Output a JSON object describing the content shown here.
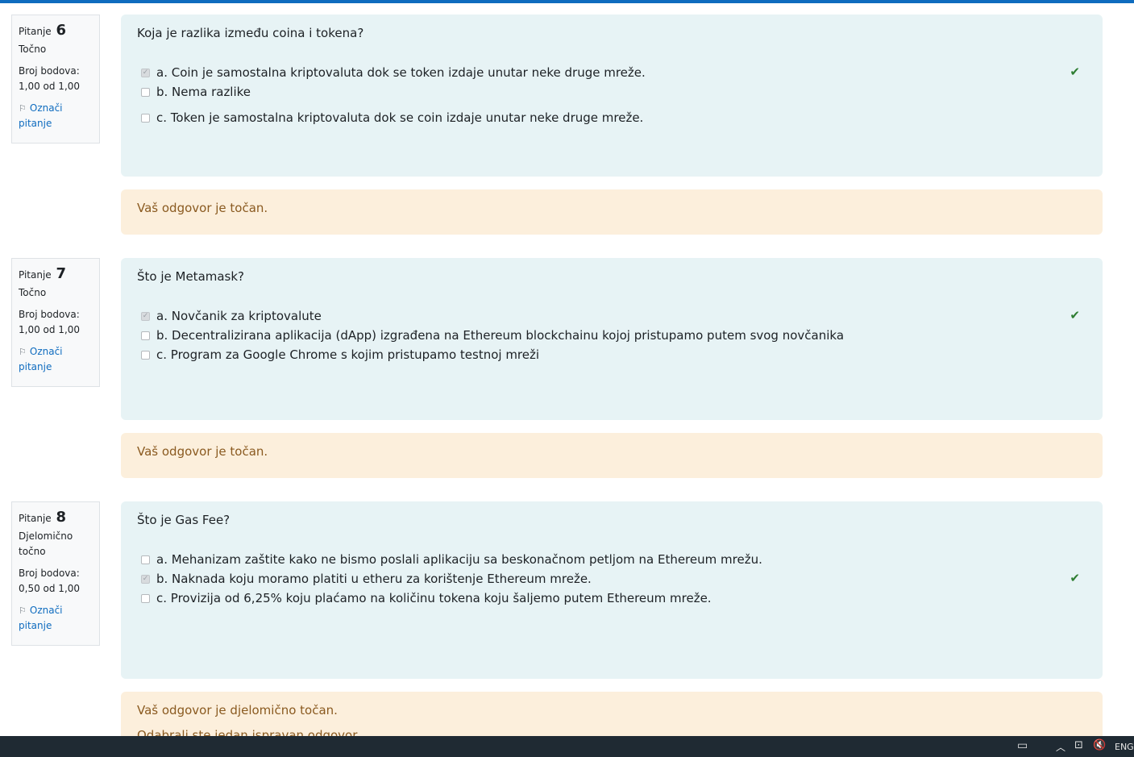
{
  "questions": [
    {
      "label": "Pitanje",
      "number": "6",
      "state": "Točno",
      "grade_label": "Broj bodova:",
      "grade_value": "1,00 od 1,00",
      "flag_label": "Označi pitanje",
      "text": "Koja je razlika između coina i tokena?",
      "answers": [
        {
          "text": "a. Coin je samostalna kriptovaluta dok se token izdaje unutar neke druge mreže.",
          "checked": true,
          "correct": true
        },
        {
          "text": "b. Nema razlike",
          "checked": false,
          "correct": false
        },
        {
          "text": "c. Token je samostalna kriptovaluta dok se coin izdaje unutar neke druge mreže.",
          "checked": false,
          "correct": false
        }
      ],
      "feedback": "Vaš odgovor je točan.",
      "feedback_sub": ""
    },
    {
      "label": "Pitanje",
      "number": "7",
      "state": "Točno",
      "grade_label": "Broj bodova:",
      "grade_value": "1,00 od 1,00",
      "flag_label": "Označi pitanje",
      "text": "Što je Metamask?",
      "answers": [
        {
          "text": "a. Novčanik za kriptovalute",
          "checked": true,
          "correct": true
        },
        {
          "text": "b. Decentralizirana aplikacija (dApp) izgrađena na Ethereum blockchainu kojoj pristupamo putem svog novčanika",
          "checked": false,
          "correct": false
        },
        {
          "text": "c. Program za Google Chrome s kojim pristupamo testnoj mreži",
          "checked": false,
          "correct": false
        }
      ],
      "feedback": "Vaš odgovor je točan.",
      "feedback_sub": ""
    },
    {
      "label": "Pitanje",
      "number": "8",
      "state": "Djelomično točno",
      "grade_label": "Broj bodova:",
      "grade_value": "0,50 od 1,00",
      "flag_label": "Označi pitanje",
      "text": "Što je Gas Fee?",
      "answers": [
        {
          "text": "a. Mehanizam zaštite kako ne bismo poslali aplikaciju sa beskonačnom petljom na Ethereum mrežu.",
          "checked": false,
          "correct": false
        },
        {
          "text": "b. Naknada koju moramo platiti u etheru za korištenje Ethereum mreže.",
          "checked": true,
          "correct": true
        },
        {
          "text": "c. Provizija od 6,25% koju plaćamo na količinu tokena koju šaljemo putem Ethereum mreže.",
          "checked": false,
          "correct": false
        }
      ],
      "feedback": "Vaš odgovor je djelomično točan.",
      "feedback_sub": "Odabrali ste jedan ispravan odgovor."
    }
  ],
  "taskbar": {
    "language": "ENG"
  },
  "colors": {
    "accent": "#0f6cbf",
    "formulation_bg": "#e7f3f5",
    "feedback_bg": "#fcefdc",
    "correct": "#2e7d32"
  }
}
